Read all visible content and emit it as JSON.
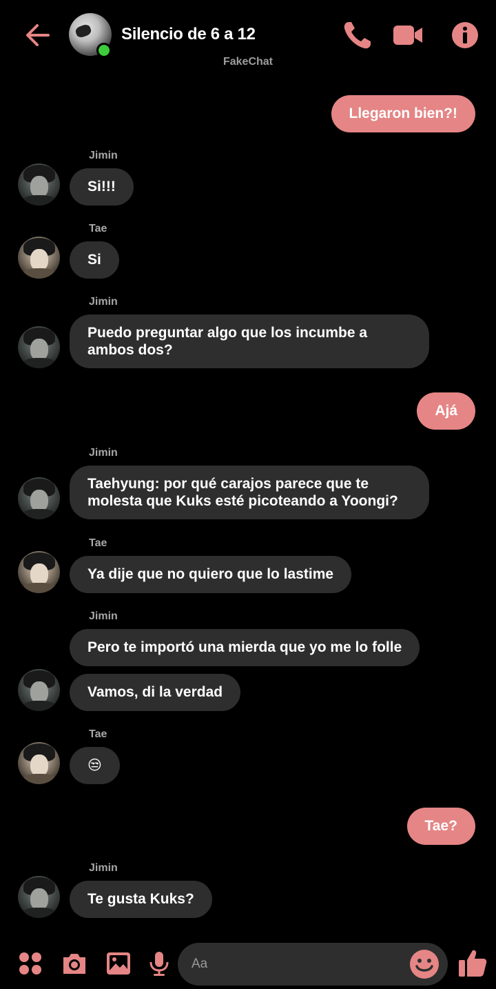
{
  "header": {
    "title": "Silencio de 6 a 12",
    "subtitle": "FakeChat",
    "accent": "#e58585"
  },
  "messages": [
    {
      "sender": "",
      "text": "Llegaron bien?!",
      "mine": true
    },
    {
      "sender": "Jimin",
      "text": "Si!!!"
    },
    {
      "sender": "Tae",
      "text": "Si"
    },
    {
      "sender": "Jimin",
      "text": "Puedo preguntar algo que los incumbe a ambos dos?"
    },
    {
      "sender": "",
      "text": "Ajá",
      "mine": true
    },
    {
      "sender": "Jimin",
      "text": "Taehyung: por qué carajos parece que te molesta que Kuks esté picoteando a Yoongi?"
    },
    {
      "sender": "Tae",
      "text": "Ya dije que no quiero que lo lastime"
    },
    {
      "sender": "Jimin",
      "text": "Pero te importó una mierda que yo me lo folle"
    },
    {
      "sender": "",
      "text": "Vamos, di la verdad"
    },
    {
      "sender": "Tae",
      "text": "😒"
    },
    {
      "sender": "",
      "text": "Tae?",
      "mine": true
    },
    {
      "sender": "Jimin",
      "text": "Te gusta Kuks?"
    }
  ],
  "composer": {
    "placeholder": "Aa"
  },
  "icons": {
    "back": "arrow-left-icon",
    "call": "phone-icon",
    "video": "video-camera-icon",
    "info": "info-icon",
    "menu": "four-dots-icon",
    "camera": "camera-icon",
    "gallery": "image-icon",
    "mic": "microphone-icon",
    "emoji": "smiley-icon",
    "like": "thumbs-up-icon"
  }
}
